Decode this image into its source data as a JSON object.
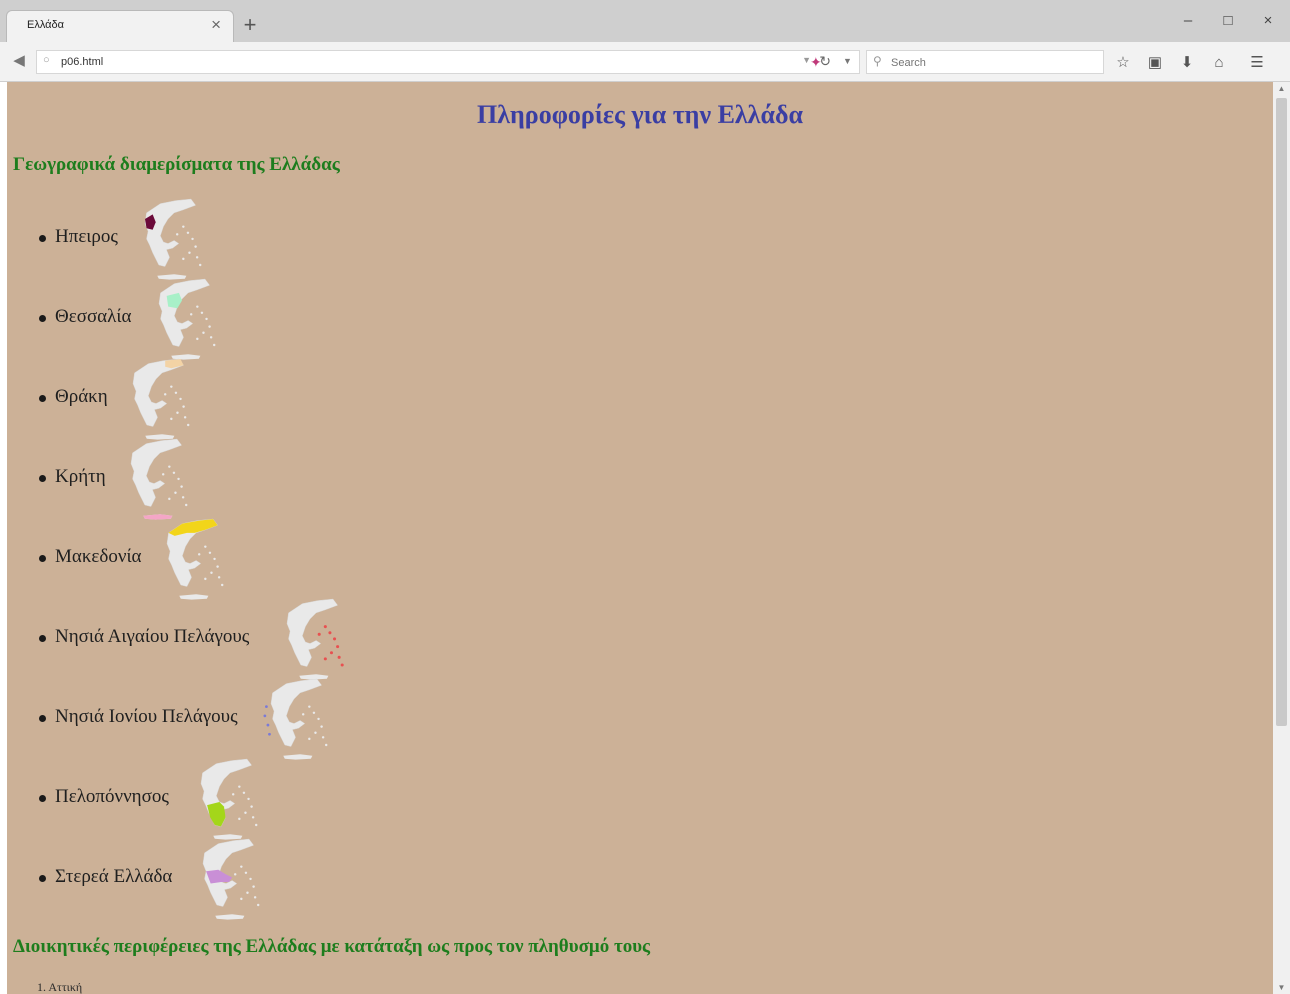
{
  "browser": {
    "tab_title": "Ελλάδα",
    "tab_close": "×",
    "new_tab": "+",
    "url": "p06.html",
    "search_placeholder": "Search",
    "window_controls": {
      "minimize": "–",
      "maximize": "□",
      "close": "×"
    }
  },
  "page": {
    "title": "Πληροφορίες για την Ελλάδα",
    "section1_heading": "Γεωγραφικά διαμερίσματα της Ελλάδας",
    "regions": [
      {
        "label": "Ηπειρος",
        "highlight_color": "#6b0a3a"
      },
      {
        "label": "Θεσσαλία",
        "highlight_color": "#a8f0c8"
      },
      {
        "label": "Θράκη",
        "highlight_color": "#f3d3a5"
      },
      {
        "label": "Κρήτη",
        "highlight_color": "#f4a6c6"
      },
      {
        "label": "Μακεδονία",
        "highlight_color": "#f2d51a"
      },
      {
        "label": "Νησιά Αιγαίου Πελάγους",
        "highlight_color": "#e85050"
      },
      {
        "label": "Νησιά Ιονίου Πελάγους",
        "highlight_color": "#7a7ad8"
      },
      {
        "label": "Πελοπόννησος",
        "highlight_color": "#a4d61a"
      },
      {
        "label": "Στερεά Ελλάδα",
        "highlight_color": "#c98fd6"
      }
    ],
    "section2_heading": "Διοικητικές περιφέρειες της Ελλάδας με κατάταξη ως προς τον πληθυσμό τους",
    "admin_regions": [
      "1. Αττική"
    ]
  },
  "colors": {
    "page_background": "#ccb197",
    "title_color": "#3a3ea3",
    "heading_color": "#1d7d1d",
    "map_land": "#e9e9e9"
  },
  "icons": {
    "back": "back-arrow-icon",
    "reload": "reload-icon",
    "search": "search-icon",
    "bookmark": "star-icon",
    "library": "library-icon",
    "downloads": "download-icon",
    "home": "home-icon",
    "menu": "hamburger-menu-icon"
  }
}
